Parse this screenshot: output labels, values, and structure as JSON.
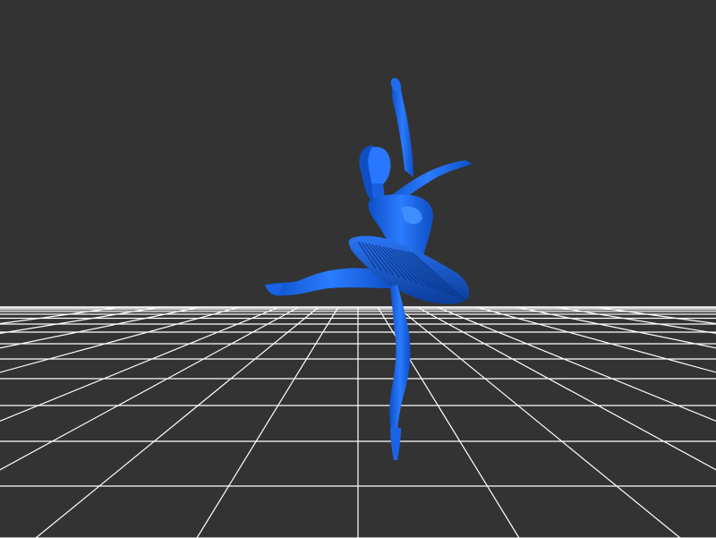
{
  "viewer": {
    "background_color": "#333333",
    "grid_color": "#ffffff",
    "model_color": "#1565f0",
    "model_highlight_color": "#3d8bff",
    "model_shadow_color": "#0a3f9e",
    "grid_visible": true
  }
}
